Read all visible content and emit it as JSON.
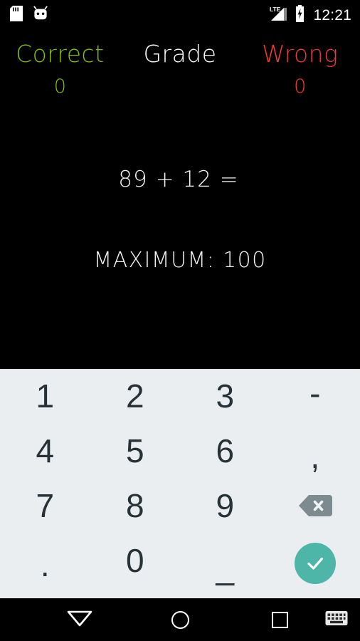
{
  "status_bar": {
    "icons_left": [
      "sd-card-icon",
      "android-marshmallow-icon"
    ],
    "icons_right": [
      "lte-signal-icon",
      "battery-charging-icon"
    ],
    "network_label": "LTE",
    "clock": "12:21"
  },
  "app": {
    "scoreboard": {
      "correct": {
        "label": "Correct",
        "value": "0",
        "color": "#80C000"
      },
      "grade": {
        "label": "Grade",
        "value": "",
        "color": "#FFFFFF"
      },
      "wrong": {
        "label": "Wrong",
        "value": "0",
        "color": "#EE3B33"
      }
    },
    "question": {
      "text": "89 + 12 =",
      "answer": "",
      "operand_a": "89",
      "operator": "+",
      "operand_b": "12"
    },
    "maximum_label": "MAXIMUM: 100",
    "maximum_value": "100"
  },
  "keyboard": {
    "type": "numeric",
    "background": "#EAEEF1",
    "key_color": "#263238",
    "enter_color": "#4DB6A8",
    "backspace_color": "#7D8B91",
    "rows": [
      [
        {
          "label": "1",
          "name": "key-1",
          "kind": "digit"
        },
        {
          "label": "2",
          "name": "key-2",
          "kind": "digit"
        },
        {
          "label": "3",
          "name": "key-3",
          "kind": "digit"
        },
        {
          "label": "-",
          "name": "key-minus",
          "kind": "symbol"
        }
      ],
      [
        {
          "label": "4",
          "name": "key-4",
          "kind": "digit"
        },
        {
          "label": "5",
          "name": "key-5",
          "kind": "digit"
        },
        {
          "label": "6",
          "name": "key-6",
          "kind": "digit"
        },
        {
          "label": ",",
          "name": "key-comma",
          "kind": "symbol"
        }
      ],
      [
        {
          "label": "7",
          "name": "key-7",
          "kind": "digit"
        },
        {
          "label": "8",
          "name": "key-8",
          "kind": "digit"
        },
        {
          "label": "9",
          "name": "key-9",
          "kind": "digit"
        },
        {
          "label": "",
          "name": "key-backspace",
          "kind": "backspace"
        }
      ],
      [
        {
          "label": ".",
          "name": "key-period",
          "kind": "symbol"
        },
        {
          "label": "0",
          "name": "key-0",
          "kind": "digit"
        },
        {
          "label": "_",
          "name": "key-space",
          "kind": "symbol"
        },
        {
          "label": "",
          "name": "key-enter",
          "kind": "enter"
        }
      ]
    ]
  },
  "nav_bar": {
    "back": "back-triangle-icon",
    "home": "home-circle-icon",
    "recents": "recents-square-icon",
    "keyboard_switch": "keyboard-switcher-icon"
  }
}
